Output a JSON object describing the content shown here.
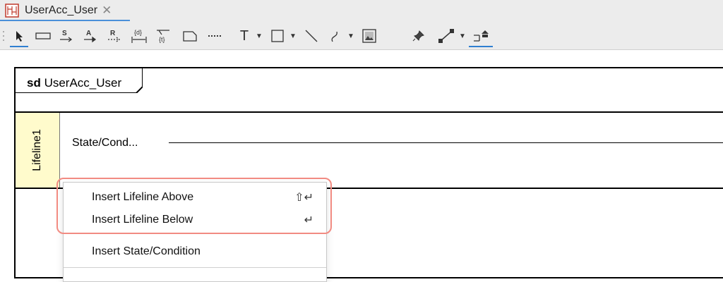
{
  "tab": {
    "title": "UserAcc_User",
    "close": "✕"
  },
  "toolbar": {
    "t_label": "T",
    "dropdown": "▼",
    "items": [
      "select-tool",
      "rectangle-tool",
      "sync-message-tool",
      "async-message-tool",
      "reply-message-tool",
      "duration-constraint-tool",
      "time-constraint-tool",
      "note-tool",
      "dotted-line-tool",
      "text-tool",
      "box-tool",
      "line-tool",
      "curve-tool",
      "image-tool",
      "pin-tool",
      "connector-tool",
      "align-tool"
    ]
  },
  "diagram": {
    "sd_keyword": "sd",
    "sd_name": "UserAcc_User",
    "lifeline": "Lifeline1",
    "state": "State/Cond..."
  },
  "menu": {
    "items": [
      {
        "label": "Insert Lifeline Above",
        "shortcut": "⇧↵"
      },
      {
        "label": "Insert Lifeline Below",
        "shortcut": "↵"
      },
      {
        "label": "Insert State/Condition",
        "shortcut": ""
      }
    ]
  }
}
